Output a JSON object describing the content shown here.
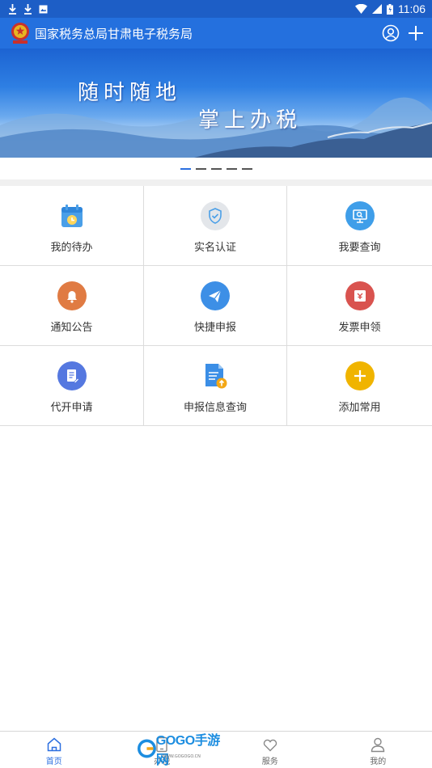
{
  "status_bar": {
    "time": "11:06"
  },
  "app_bar": {
    "title": "国家税务总局甘肃电子税务局"
  },
  "banner": {
    "line1": "随时随地",
    "line2": "掌上办税"
  },
  "carousel": {
    "page_count": 5,
    "active_index": 0
  },
  "grid": [
    {
      "label": "我的待办",
      "icon": "calendar-clock-icon",
      "color": "#4a9fe8"
    },
    {
      "label": "实名认证",
      "icon": "shield-check-icon",
      "color": "#d8d8d8"
    },
    {
      "label": "我要查询",
      "icon": "monitor-search-icon",
      "color": "#3f9ee9"
    },
    {
      "label": "通知公告",
      "icon": "bell-icon",
      "color": "#e07b43"
    },
    {
      "label": "快捷申报",
      "icon": "paper-plane-icon",
      "color": "#3d8fe6"
    },
    {
      "label": "发票申领",
      "icon": "invoice-icon",
      "color": "#d9534f"
    },
    {
      "label": "代开申请",
      "icon": "document-edit-icon",
      "color": "#5578e0"
    },
    {
      "label": "申报信息查询",
      "icon": "document-upload-icon",
      "color": "#3b8ee6"
    },
    {
      "label": "添加常用",
      "icon": "plus-circle-icon",
      "color": "#f0b400"
    }
  ],
  "bottom_nav": [
    {
      "label": "首页",
      "icon": "home-icon",
      "active": true
    },
    {
      "label": "办税",
      "icon": "tablet-icon",
      "active": false
    },
    {
      "label": "服务",
      "icon": "heart-icon",
      "active": false
    },
    {
      "label": "我的",
      "icon": "user-icon",
      "active": false
    }
  ],
  "watermark": {
    "text": "GOGO手游网",
    "sub": "WWW.GOGOGO.CN"
  }
}
